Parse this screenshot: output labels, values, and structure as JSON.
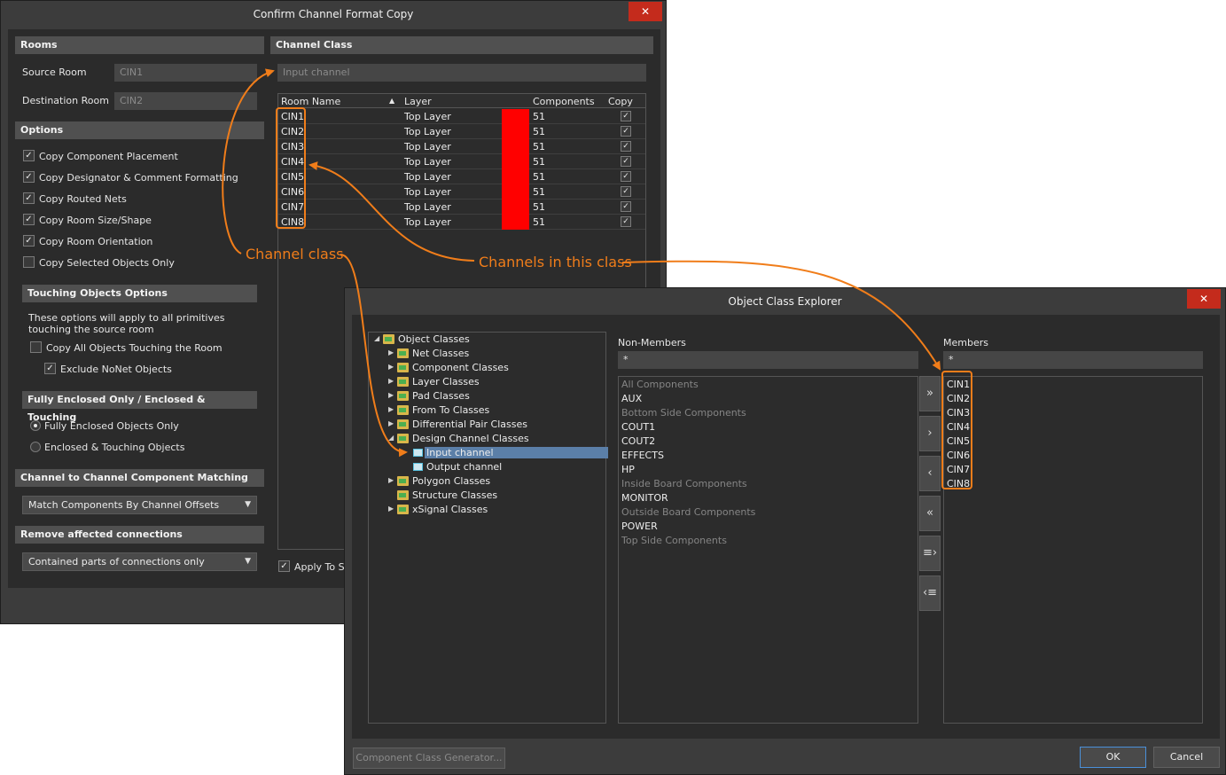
{
  "confirm_dialog": {
    "title": "Confirm Channel Format Copy",
    "close_glyph": "✕",
    "rooms": {
      "header": "Rooms",
      "source_label": "Source Room",
      "source_value": "CIN1",
      "dest_label": "Destination Room",
      "dest_value": "CIN2"
    },
    "options": {
      "header": "Options",
      "items": [
        {
          "label": "Copy Component Placement",
          "checked": true
        },
        {
          "label": "Copy Designator & Comment Formatting",
          "checked": true
        },
        {
          "label": "Copy Routed Nets",
          "checked": true
        },
        {
          "label": "Copy Room Size/Shape",
          "checked": true
        },
        {
          "label": "Copy Room Orientation",
          "checked": true
        },
        {
          "label": "Copy Selected Objects Only",
          "checked": false
        }
      ]
    },
    "touching": {
      "header": "Touching Objects Options",
      "note_line1": "These options will apply to all primitives",
      "note_line2": "touching the source room",
      "copy_all_label": "Copy All Objects Touching the Room",
      "exclude_nonet_label": "Exclude NoNet Objects"
    },
    "enclosed": {
      "header": "Fully Enclosed Only / Enclosed & Touching",
      "fully_label": "Fully Enclosed Objects Only",
      "enclosed_touching_label": "Enclosed & Touching Objects"
    },
    "matching": {
      "header": "Channel to Channel Component Matching",
      "value": "Match Components By Channel Offsets"
    },
    "remove": {
      "header": "Remove affected connections",
      "value": "Contained parts of connections only"
    },
    "channel_class": {
      "header": "Channel Class",
      "value": "Input channel",
      "columns": [
        "Room Name",
        "Layer",
        "Components",
        "Copy"
      ],
      "rows": [
        {
          "room": "CIN1",
          "layer": "Top Layer",
          "color": "#ff0000",
          "components": "51",
          "copy": true
        },
        {
          "room": "CIN2",
          "layer": "Top Layer",
          "color": "#ff0000",
          "components": "51",
          "copy": true
        },
        {
          "room": "CIN3",
          "layer": "Top Layer",
          "color": "#ff0000",
          "components": "51",
          "copy": true
        },
        {
          "room": "CIN4",
          "layer": "Top Layer",
          "color": "#ff0000",
          "components": "51",
          "copy": true
        },
        {
          "room": "CIN5",
          "layer": "Top Layer",
          "color": "#ff0000",
          "components": "51",
          "copy": true
        },
        {
          "room": "CIN6",
          "layer": "Top Layer",
          "color": "#ff0000",
          "components": "51",
          "copy": true
        },
        {
          "room": "CIN7",
          "layer": "Top Layer",
          "color": "#ff0000",
          "components": "51",
          "copy": true
        },
        {
          "room": "CIN8",
          "layer": "Top Layer",
          "color": "#ff0000",
          "components": "51",
          "copy": true
        }
      ],
      "apply_label": "Apply To Sp"
    }
  },
  "explorer_dialog": {
    "title": "Object Class Explorer",
    "close_glyph": "✕",
    "tree": [
      {
        "label": "Object Classes",
        "icon": "root-classes-icon",
        "level": 0,
        "expanded": true
      },
      {
        "label": "Net Classes",
        "icon": "folder-icon",
        "level": 1,
        "expanded": false
      },
      {
        "label": "Component Classes",
        "icon": "folder-icon",
        "level": 1,
        "expanded": false
      },
      {
        "label": "Layer Classes",
        "icon": "folder-icon",
        "level": 1,
        "expanded": false
      },
      {
        "label": "Pad Classes",
        "icon": "folder-icon",
        "level": 1,
        "expanded": false
      },
      {
        "label": "From To Classes",
        "icon": "folder-icon",
        "level": 1,
        "expanded": false
      },
      {
        "label": "Differential Pair Classes",
        "icon": "folder-icon",
        "level": 1,
        "expanded": false
      },
      {
        "label": "Design Channel Classes",
        "icon": "folder-icon",
        "level": 1,
        "expanded": true
      },
      {
        "label": "Input channel",
        "icon": "channel-class-icon",
        "level": 2,
        "selected": true
      },
      {
        "label": "Output channel",
        "icon": "channel-class-icon",
        "level": 2
      },
      {
        "label": "Polygon Classes",
        "icon": "folder-icon",
        "level": 1,
        "expanded": false
      },
      {
        "label": "Structure Classes",
        "icon": "folder-icon",
        "level": 1
      },
      {
        "label": "xSignal Classes",
        "icon": "folder-icon",
        "level": 1,
        "expanded": false
      }
    ],
    "non_members": {
      "label": "Non-Members",
      "filter": "*",
      "items": [
        {
          "label": "All Components",
          "dim": true
        },
        {
          "label": "AUX",
          "dim": false
        },
        {
          "label": "Bottom Side Components",
          "dim": true
        },
        {
          "label": "COUT1",
          "dim": false
        },
        {
          "label": "COUT2",
          "dim": false
        },
        {
          "label": "EFFECTS",
          "dim": false
        },
        {
          "label": "HP",
          "dim": false
        },
        {
          "label": "Inside Board Components",
          "dim": true
        },
        {
          "label": "MONITOR",
          "dim": false
        },
        {
          "label": "Outside Board Components",
          "dim": true
        },
        {
          "label": "POWER",
          "dim": false
        },
        {
          "label": "Top Side Components",
          "dim": true
        }
      ]
    },
    "members": {
      "label": "Members",
      "filter": "*",
      "items": [
        "CIN1",
        "CIN2",
        "CIN3",
        "CIN4",
        "CIN5",
        "CIN6",
        "CIN7",
        "CIN8"
      ]
    },
    "move_buttons": [
      "»",
      "›",
      "‹",
      "«",
      "≡›",
      "‹≡"
    ],
    "generator_label": "Component Class Generator...",
    "ok_label": "OK",
    "cancel_label": "Cancel"
  },
  "annotations": {
    "channel_class": "Channel class",
    "channels_in_class": "Channels in this class",
    "color": "#f07d1a"
  }
}
